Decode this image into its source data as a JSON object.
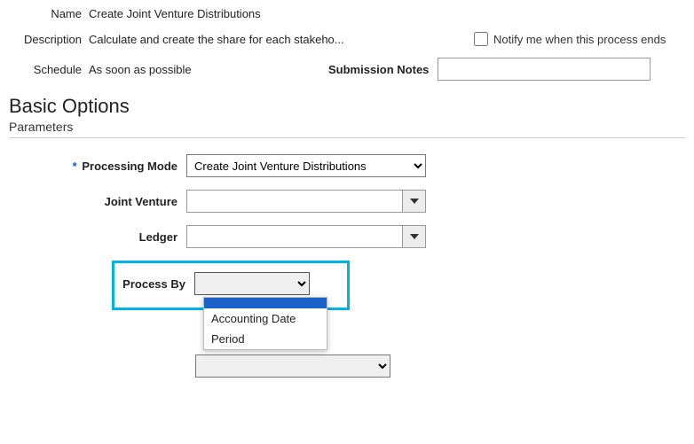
{
  "header": {
    "name_label": "Name",
    "name_value": "Create Joint Venture Distributions",
    "description_label": "Description",
    "description_value": "Calculate and create the share for each stakeho...",
    "notify_label": "Notify me when this process ends",
    "notify_checked": false,
    "schedule_label": "Schedule",
    "schedule_value": "As soon as possible",
    "submission_notes_label": "Submission Notes",
    "submission_notes_value": ""
  },
  "section": {
    "title": "Basic Options",
    "subtitle": "Parameters"
  },
  "params": {
    "processing_mode": {
      "label": "Processing Mode",
      "required_marker": "*",
      "value": "Create Joint Venture Distributions"
    },
    "joint_venture": {
      "label": "Joint Venture",
      "value": ""
    },
    "ledger": {
      "label": "Ledger",
      "value": ""
    },
    "process_by": {
      "label": "Process By",
      "value": "",
      "options": {
        "blank": "",
        "accounting_date": "Accounting Date",
        "period": "Period"
      }
    },
    "extra_dropdown": {
      "value": ""
    }
  }
}
